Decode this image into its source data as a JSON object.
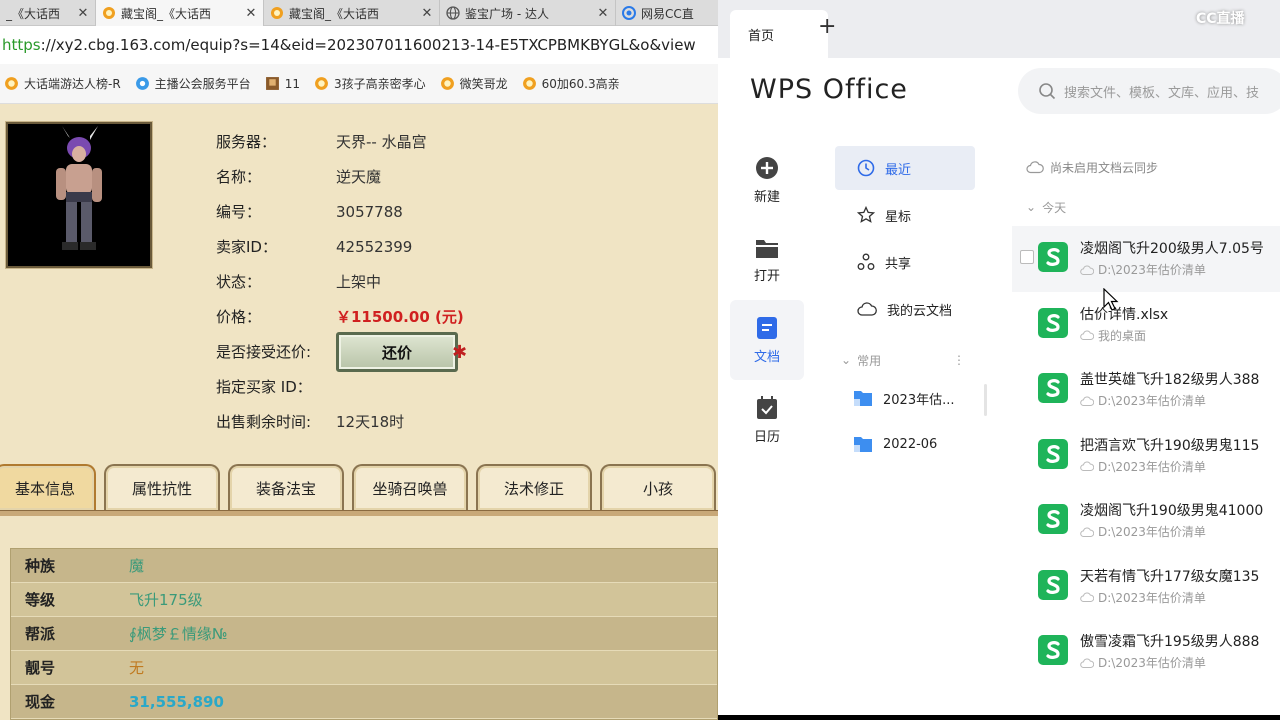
{
  "browser": {
    "tabs": [
      {
        "label": "_《大话西",
        "active": false
      },
      {
        "label": "藏宝阁_《大话西",
        "active": true
      },
      {
        "label": "藏宝阁_《大话西",
        "active": false
      },
      {
        "label": "鉴宝广场 - 达人",
        "active": false
      },
      {
        "label": "网易CC直",
        "active": false
      }
    ],
    "url_protocol": "https",
    "url_rest": "://xy2.cbg.163.com/equip?s=14&eid=202307011600213-14-E5TXCPBMKBYGL&o&view",
    "bookmarks": [
      "大话端游达人榜-R",
      "主播公会服务平台",
      "11",
      "3孩子高亲密孝心",
      "微笑哥龙",
      "60加60.3高亲"
    ]
  },
  "listing": {
    "server_label": "服务器：",
    "server_value": "天界-- 水晶宫",
    "name_label": "名称：",
    "name_value": "逆天魔",
    "number_label": "编号：",
    "number_value": "3057788",
    "seller_label": "卖家ID：",
    "seller_value": "42552399",
    "status_label": "状态：",
    "status_value": "上架中",
    "price_label": "价格：",
    "price_value": "￥11500.00 (元)",
    "counter_label": "是否接受还价:",
    "counter_button": "还价",
    "buyer_label": "指定买家 ID：",
    "remaining_label": "出售剩余时间:",
    "remaining_value": "12天18时"
  },
  "detail_tabs": [
    "基本信息",
    "属性抗性",
    "装备法宝",
    "坐骑召唤兽",
    "法术修正",
    "小孩"
  ],
  "attributes": [
    {
      "key": "种族",
      "value": "魔"
    },
    {
      "key": "等级",
      "value": "飞升175级"
    },
    {
      "key": "帮派",
      "value": "∮枫梦￡情缘№"
    },
    {
      "key": "靓号",
      "value": "无"
    },
    {
      "key": "现金",
      "value": "31,555,890"
    }
  ],
  "wps": {
    "home_tab": "首页",
    "cc_logo": "CC直播",
    "logo": "WPS Office",
    "search_placeholder": "搜索文件、模板、文库、应用、技",
    "left_nav": [
      {
        "label": "新建",
        "icon": "plus-circle-icon"
      },
      {
        "label": "打开",
        "icon": "folder-icon"
      },
      {
        "label": "文档",
        "icon": "document-icon",
        "active": true
      },
      {
        "label": "日历",
        "icon": "calendar-icon"
      }
    ],
    "middle_nav": [
      {
        "label": "最近",
        "icon": "clock-icon",
        "active": true
      },
      {
        "label": "星标",
        "icon": "star-icon"
      },
      {
        "label": "共享",
        "icon": "share-icon"
      },
      {
        "label": "我的云文档",
        "icon": "cloud-icon"
      }
    ],
    "common_label": "常用",
    "common_folders": [
      "2023年估...",
      "2022-06"
    ],
    "sync_status": "尚未启用文档云同步",
    "today_label": "今天",
    "files": [
      {
        "name": "凌烟阁飞升200级男人7.05号",
        "path": "D:\\2023年估价清单"
      },
      {
        "name": "估价详情.xlsx",
        "path": "我的桌面"
      },
      {
        "name": "盖世英雄飞升182级男人388",
        "path": "D:\\2023年估价清单"
      },
      {
        "name": "把酒言欢飞升190级男鬼115",
        "path": "D:\\2023年估价清单"
      },
      {
        "name": "凌烟阁飞升190级男鬼41000",
        "path": "D:\\2023年估价清单"
      },
      {
        "name": "天若有情飞升177级女魔135",
        "path": "D:\\2023年估价清单"
      },
      {
        "name": "傲雪凌霜飞升195级男人888",
        "path": "D:\\2023年估价清单"
      }
    ]
  },
  "colors": {
    "wps_accent": "#2f6be8",
    "sheet_green": "#1fb45a",
    "price_red": "#d02020"
  }
}
